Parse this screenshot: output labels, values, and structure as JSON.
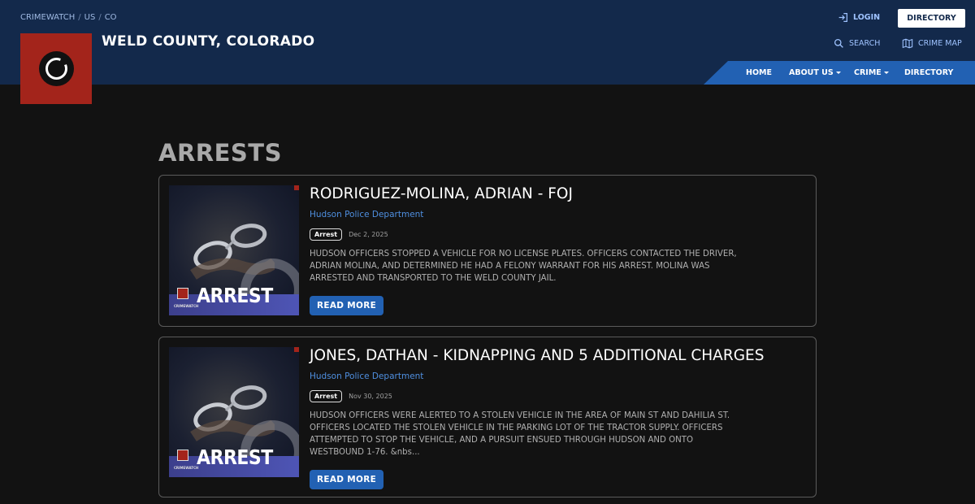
{
  "breadcrumb": {
    "items": [
      "CRIMEWATCH",
      "US",
      "CO"
    ],
    "separator": "/"
  },
  "site": {
    "title": "WELD COUNTY, COLORADO",
    "logo_color": "#a3241b"
  },
  "top_links": {
    "login": "LOGIN",
    "directory_button": "DIRECTORY",
    "search": "SEARCH",
    "crime_map": "CRIME MAP"
  },
  "nav": {
    "items": [
      "HOME",
      "ABOUT US",
      "CRIME",
      "DIRECTORY"
    ],
    "color": "#2261b3"
  },
  "page": {
    "title": "ARRESTS"
  },
  "posts": [
    {
      "title": "RODRIGUEZ-MOLINA, ADRIAN - FOJ",
      "agency": "Hudson Police Department",
      "badge": "Arrest",
      "date": "Dec 2, 2025",
      "excerpt": "HUDSON OFFICERS STOPPED A VEHICLE FOR NO LICENSE PLATES.  OFFICERS CONTACTED THE DRIVER, ADRIAN MOLINA, AND DETERMINED HE HAD A FELONY WARRANT FOR HIS ARREST. MOLINA WAS ARRESTED AND TRANSPORTED TO THE WELD COUNTY JAIL.",
      "button": "READ MORE",
      "thumb_word": "ARREST",
      "thumb_brand": "CRIMEWATCH"
    },
    {
      "title": "JONES, DATHAN - KIDNAPPING AND 5 ADDITIONAL CHARGES",
      "agency": "Hudson Police Department",
      "badge": "Arrest",
      "date": "Nov 30, 2025",
      "excerpt": "HUDSON OFFICERS WERE ALERTED TO A STOLEN VEHICLE IN THE AREA OF MAIN ST AND DAHILIA ST.  OFFICERS LOCATED THE STOLEN VEHICLE IN THE PARKING LOT OF THE TRACTOR SUPPLY. OFFICERS ATTEMPTED TO STOP THE VEHICLE, AND A PURSUIT ENSUED THROUGH HUDSON AND ONTO WESTBOUND 1-76. &nbs...",
      "button": "READ MORE",
      "thumb_word": "ARREST",
      "thumb_brand": "CRIMEWATCH"
    }
  ]
}
